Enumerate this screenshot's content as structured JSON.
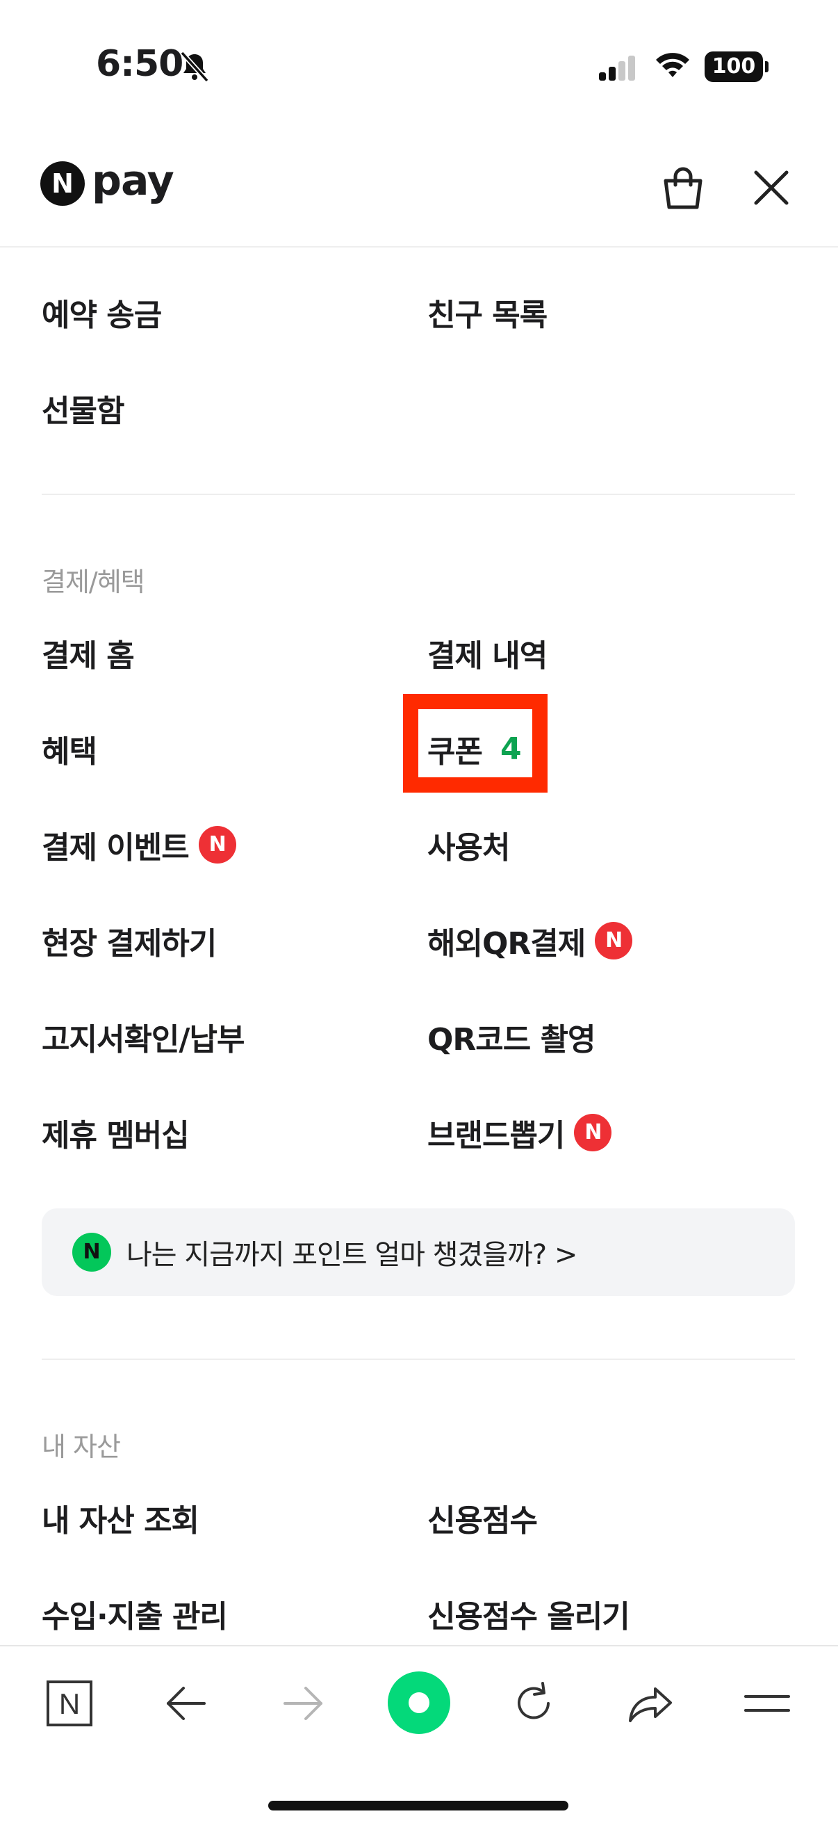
{
  "status_bar": {
    "time": "6:50",
    "battery": "100"
  },
  "header": {
    "logo_badge": "N",
    "logo_text": "pay"
  },
  "menu_top": [
    {
      "label": "예약 송금"
    },
    {
      "label": "친구 목록"
    },
    {
      "label": "선물함"
    }
  ],
  "sections": {
    "payment": {
      "title": "결제/혜택",
      "items": [
        {
          "label": "결제 홈"
        },
        {
          "label": "결제 내역"
        },
        {
          "label": "혜택"
        },
        {
          "label": "쿠폰",
          "count": "4"
        },
        {
          "label": "결제 이벤트",
          "badge": "N"
        },
        {
          "label": "사용처"
        },
        {
          "label": "현장 결제하기"
        },
        {
          "label": "해외QR결제",
          "badge": "N"
        },
        {
          "label": "고지서확인/납부"
        },
        {
          "label": "QR코드 촬영"
        },
        {
          "label": "제휴 멤버십"
        },
        {
          "label": "브랜드뽑기",
          "badge": "N"
        }
      ]
    },
    "points_banner": {
      "icon_text": "N",
      "text": "나는 지금까지 포인트 얼마 챙겼을까?",
      "chevron": ">"
    },
    "assets": {
      "title": "내 자산",
      "items": [
        {
          "label": "내 자산 조회"
        },
        {
          "label": "신용점수"
        },
        {
          "label": "수입·지출 관리"
        },
        {
          "label": "신용점수 올리기"
        }
      ]
    }
  },
  "bottom_nav": {
    "home_label": "N"
  },
  "colors": {
    "badge_red": "#ee3035",
    "coupon_green": "#0da351",
    "highlight": "#ff2a00",
    "naver_green": "#03c75a"
  },
  "icons": [
    "bell-slash-icon",
    "signal-icon",
    "wifi-icon",
    "shopping-bag-icon",
    "close-icon",
    "back-arrow-icon",
    "forward-arrow-icon",
    "refresh-icon",
    "share-icon",
    "menu-icon"
  ]
}
